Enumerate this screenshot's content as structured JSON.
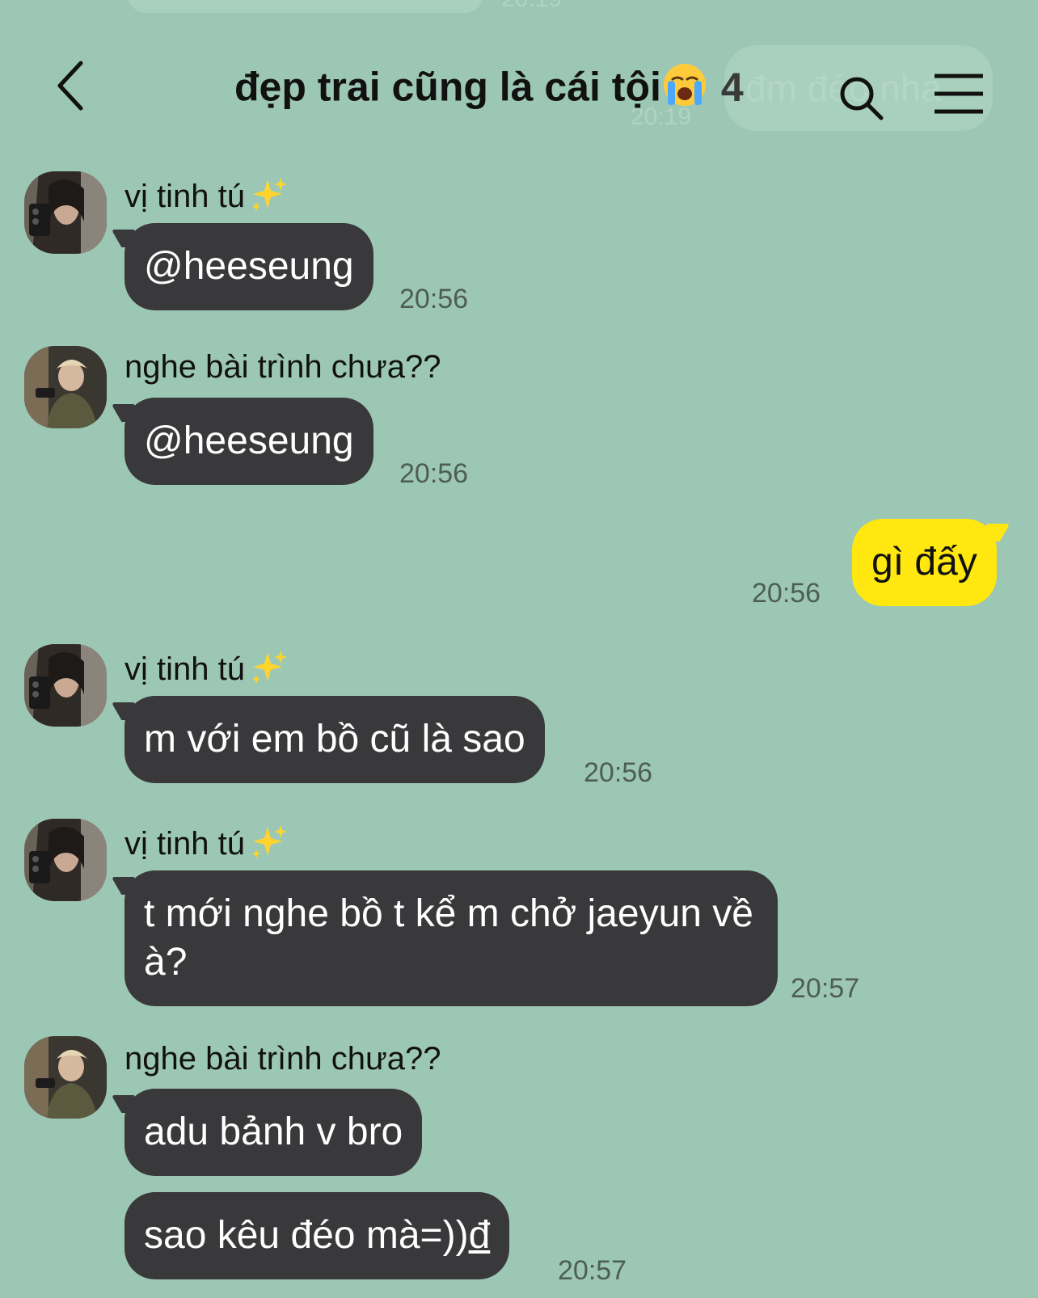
{
  "background": {
    "ghost_top_time": "20:19",
    "ghost_header_text": "đm đéo nhá",
    "ghost_header_time": "20:19"
  },
  "header": {
    "title": "đẹp trai cũng là cái tội",
    "title_emoji": "crying-face",
    "member_count": "4",
    "back_icon": "chevron-left-icon",
    "search_icon": "search-icon",
    "menu_icon": "hamburger-menu-icon"
  },
  "colors": {
    "background": "#9dc7b5",
    "incoming_bubble": "#39393b",
    "outgoing_bubble": "#ffe70f"
  },
  "messages": [
    {
      "sender": "vị tinh tú",
      "sender_emoji": "sparkles",
      "text": "@heeseung",
      "time": "20:56",
      "direction": "incoming"
    },
    {
      "sender": "nghe bài trình chưa??",
      "text": "@heeseung",
      "time": "20:56",
      "direction": "incoming"
    },
    {
      "text": "gì đấy",
      "time": "20:56",
      "direction": "outgoing"
    },
    {
      "sender": "vị tinh tú",
      "sender_emoji": "sparkles",
      "text": "m với em bồ cũ là sao",
      "time": "20:56",
      "direction": "incoming"
    },
    {
      "sender": "vị tinh tú",
      "sender_emoji": "sparkles",
      "text": "t mới nghe bồ t kể m chở jaeyun về à?",
      "time": "20:57",
      "direction": "incoming"
    },
    {
      "sender": "nghe bài trình chưa??",
      "text": "adu bảnh v bro",
      "direction": "incoming"
    },
    {
      "text": "sao kêu đéo mà=))",
      "text_suffix": "đ",
      "time": "20:57",
      "direction": "incoming"
    }
  ]
}
